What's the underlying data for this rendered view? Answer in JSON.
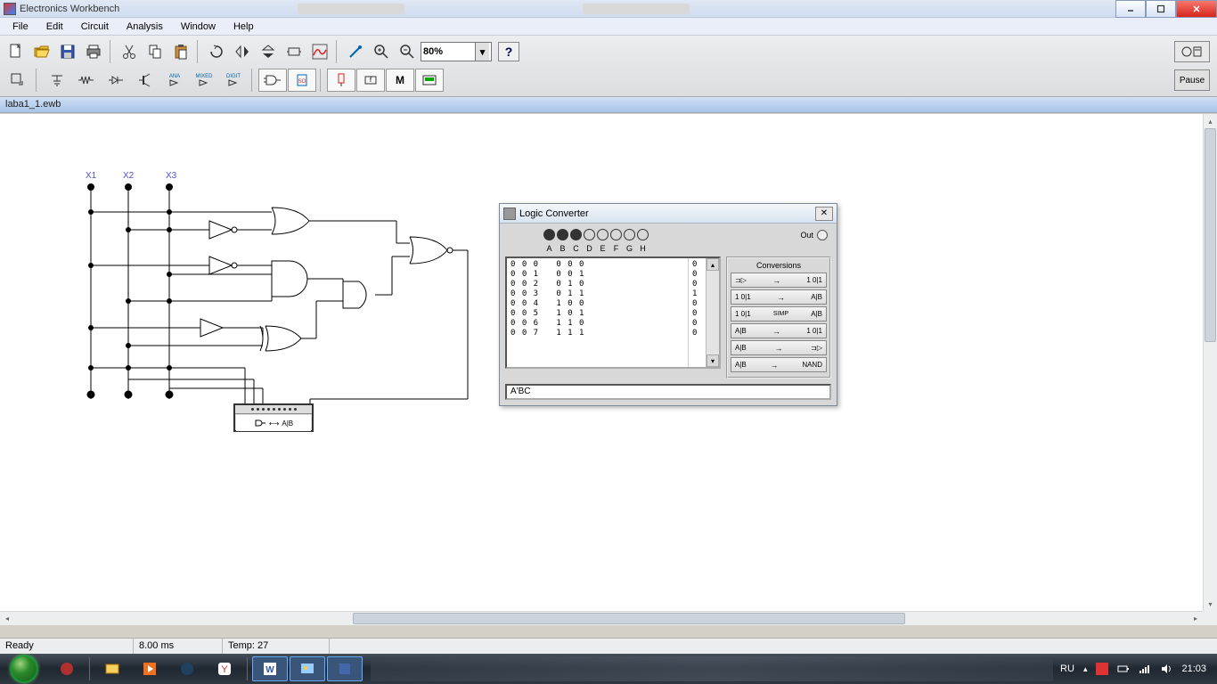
{
  "app": {
    "title": "Electronics Workbench"
  },
  "window_controls": {
    "minimize": "_",
    "maximize": "☐",
    "close": "×"
  },
  "menu": [
    "File",
    "Edit",
    "Circuit",
    "Analysis",
    "Window",
    "Help"
  ],
  "toolbar": {
    "zoom": "80%",
    "help": "?",
    "pause": "Pause"
  },
  "document": {
    "filename": "laba1_1.ewb"
  },
  "circuit": {
    "inputs": [
      "X1",
      "X2",
      "X3"
    ],
    "converter_symbol": "A|B"
  },
  "dialog": {
    "title": "Logic Converter",
    "input_labels": [
      "A",
      "B",
      "C",
      "D",
      "E",
      "F",
      "G",
      "H"
    ],
    "active_inputs": 3,
    "out_label": "Out",
    "truth_table": {
      "rows": "0 0 0   0 0 0\n0 0 1   0 0 1\n0 0 2   0 1 0\n0 0 3   0 1 1\n0 0 4   1 0 0\n0 0 5   1 0 1\n0 0 6   1 1 0\n0 0 7   1 1 1",
      "out": "0\n0\n0\n1\n0\n0\n0\n0"
    },
    "conversions": {
      "title": "Conversions",
      "buttons": [
        {
          "left": "⊐▷",
          "right": "1 0|1"
        },
        {
          "left": "1 0|1",
          "right": "A|B"
        },
        {
          "left": "1 0|1",
          "mid": "SIMP",
          "right": "A|B"
        },
        {
          "left": "A|B",
          "right": "1 0|1"
        },
        {
          "left": "A|B",
          "right": "⊐▷"
        },
        {
          "left": "A|B",
          "right": "NAND"
        }
      ]
    },
    "expression": "A'BC"
  },
  "status": {
    "ready": "Ready",
    "time": "8.00 ms",
    "temp": "Temp: 27"
  },
  "taskbar": {
    "lang": "RU",
    "clock": "21:03"
  }
}
